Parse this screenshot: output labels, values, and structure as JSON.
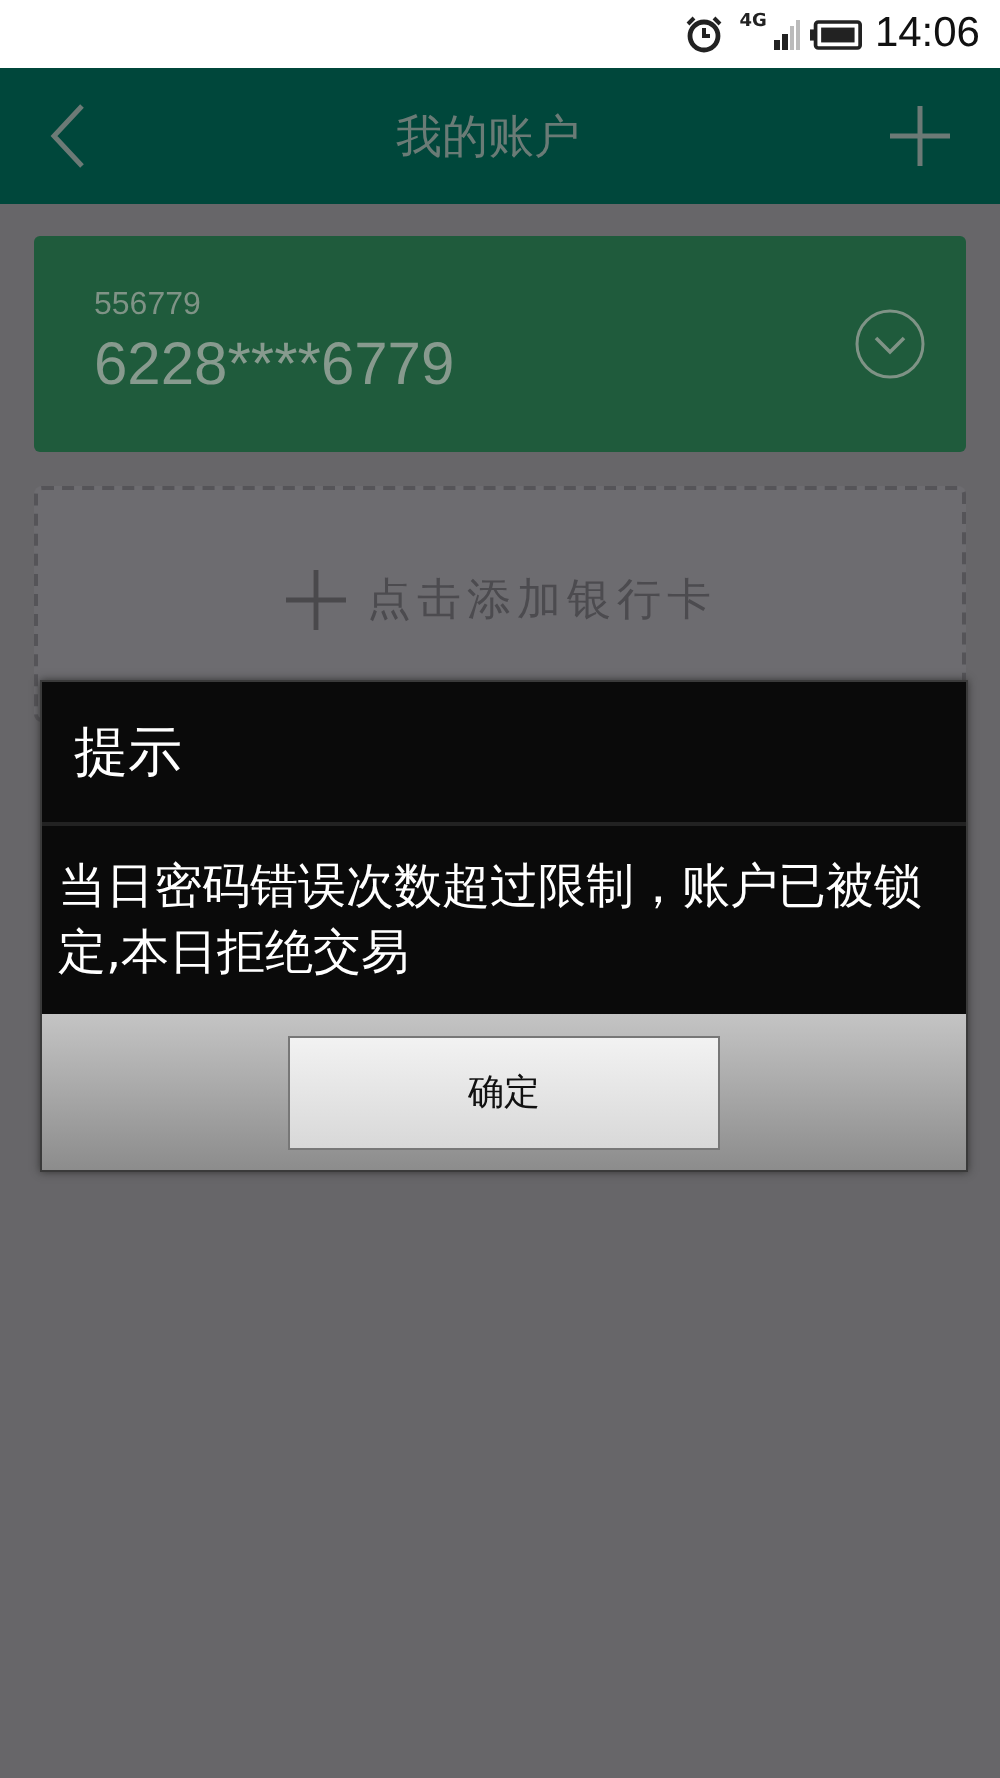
{
  "status_bar": {
    "time": "14:06",
    "network": "4G"
  },
  "header": {
    "title": "我的账户"
  },
  "account_card": {
    "label": "556779",
    "number": "6228****6779"
  },
  "add_card": {
    "label": "点击添加银行卡"
  },
  "dialog": {
    "title": "提示",
    "message": "当日密码错误次数超过限制，账户已被锁定,本日拒绝交易",
    "button": "确定"
  }
}
